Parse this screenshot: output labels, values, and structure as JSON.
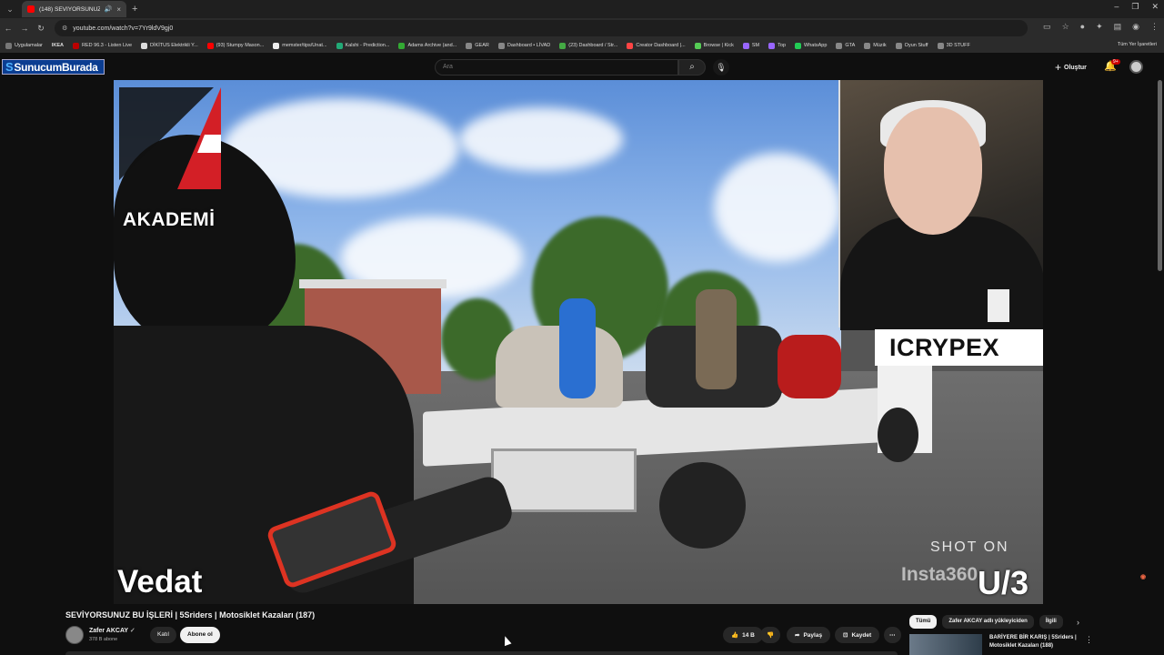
{
  "browser": {
    "tab": {
      "title": "(148) SEVİYORSUNUZ BU İŞ..."
    },
    "url": "youtube.com/watch?v=7Yr9ldV9gj0",
    "bookmarks": [
      "Uygulamalar",
      "IKEA",
      "RED 96.3 - Listen Live",
      "DİKİTUS Elektrikli Y...",
      "(93) Stumpy Mason...",
      "memster/tips/Unat...",
      "Kalshi - Prediction...",
      "Adams Archive (and...",
      "GEAR",
      "Dashboard • LİVAD",
      "(23) Dashboard / Str...",
      "Creator Dashboard |...",
      "Browse | Kick",
      "SM",
      "Top",
      "WhatsApp",
      "GTA",
      "Müzik",
      "Oyun Stuff",
      "3D STUFF"
    ],
    "bookmarks_right": "Tüm Yer İşaretleri"
  },
  "youtube": {
    "channel_logo": "SunucumBurada",
    "search_placeholder": "Ara",
    "create_label": "Oluştur",
    "notif_count": "9+"
  },
  "video": {
    "overlay": {
      "akademi": "AKADEMİ",
      "sponsor": "ICRYPEX",
      "rider_name": "Vedat",
      "shot_on": "SHOT ON",
      "camera_brand": "Insta360",
      "camera_model": "U/3"
    },
    "title": "SEVİYORSUNUZ BU İŞLERİ | 5Sriders | Motosiklet Kazaları (187)",
    "channel": "Zafer AKCAY",
    "subscribers": "378 B abone",
    "join_label": "Katıl",
    "subscribe_label": "Abone ol",
    "likes": "14 B",
    "share_label": "Paylaş",
    "save_label": "Kaydet"
  },
  "sidebar": {
    "chips": [
      "Tümü",
      "Zafer AKCAY adlı yükleyiciden",
      "İlgili"
    ],
    "next_video": {
      "title": "BARİYERE BİR KARIŞ | 5Sriders | Motosiklet Kazaları (188)"
    }
  },
  "colors": {
    "accent": "#ff0000",
    "background": "#0f0f0f",
    "chip_active": "#f1f1f1"
  }
}
